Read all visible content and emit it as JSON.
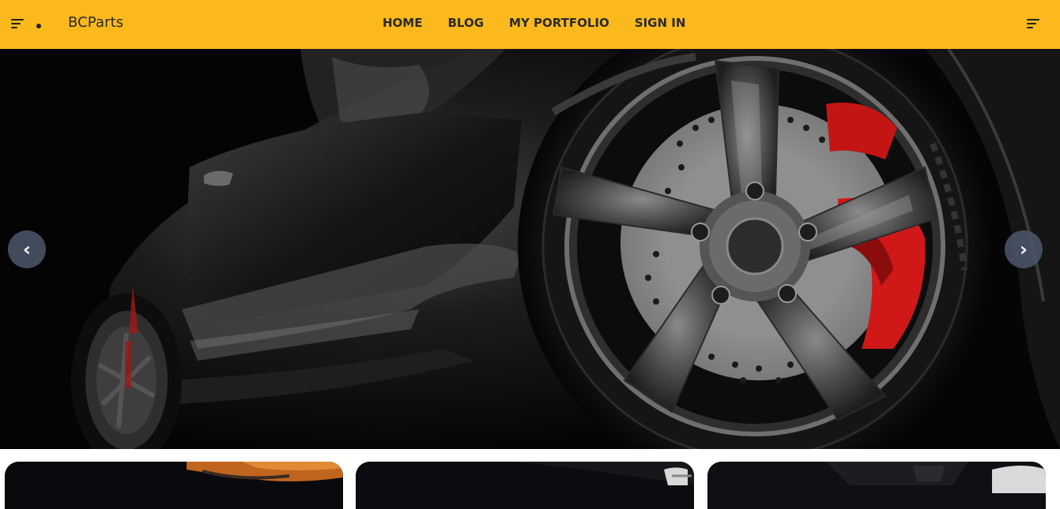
{
  "header": {
    "brand": "BCParts",
    "left_menu_icon": "menu-icon",
    "right_menu_icon": "menu-icon",
    "background_color": "#fbb91d",
    "nav": [
      {
        "label": "HOME"
      },
      {
        "label": "BLOG"
      },
      {
        "label": "MY PORTFOLIO"
      },
      {
        "label": "SIGN IN"
      }
    ]
  },
  "hero": {
    "image": "black sports car wheel with red brake caliper",
    "prev_arrow": "‹",
    "next_arrow": "›"
  },
  "cards": [
    {
      "image": "orange car detail"
    },
    {
      "image": "dark car detail"
    },
    {
      "image": "wheel detail"
    }
  ]
}
